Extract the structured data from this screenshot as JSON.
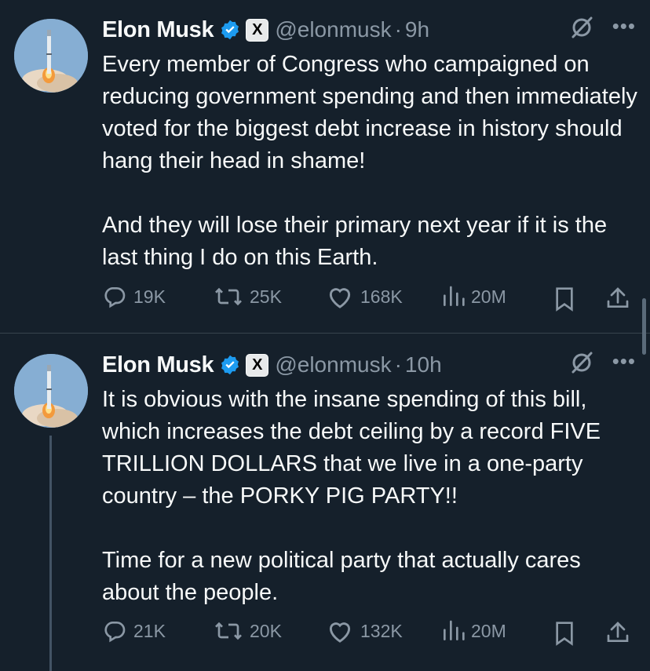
{
  "colors": {
    "background": "#15202b",
    "text": "#f7f9f9",
    "muted": "#8b98a5",
    "verified": "#1d9bf0",
    "divider": "#38444d"
  },
  "tweets": [
    {
      "author": {
        "name": "Elon Musk",
        "handle": "@elonmusk",
        "affiliate_badge": "X",
        "verified_icon": "verified-badge-icon",
        "avatar_icon": "rocket-launch-avatar"
      },
      "separator": "·",
      "time": "9h",
      "text": "Every member of Congress who campaigned on reducing government spending and then immediately voted for the biggest debt increase in history should hang their head in shame!\n\nAnd they will lose their primary next year if it is the last thing I do on this Earth.",
      "replies": "19K",
      "reposts": "25K",
      "likes": "168K",
      "views": "20M"
    },
    {
      "author": {
        "name": "Elon Musk",
        "handle": "@elonmusk",
        "affiliate_badge": "X",
        "verified_icon": "verified-badge-icon",
        "avatar_icon": "rocket-launch-avatar"
      },
      "separator": "·",
      "time": "10h",
      "text": "It is obvious with the insane spending of this bill, which increases the debt ceiling by a record FIVE TRILLION DOLLARS that we live in a one-party country – the PORKY PIG PARTY!!\n\nTime for a new political party that actually cares about the people.",
      "replies": "21K",
      "reposts": "20K",
      "likes": "132K",
      "views": "20M"
    }
  ]
}
